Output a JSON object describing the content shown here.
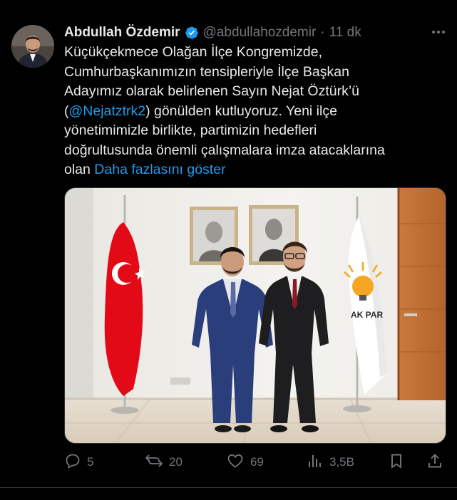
{
  "author": {
    "display_name": "Abdullah Özdemir",
    "handle": "@abdullahozdemir",
    "separator": "·",
    "time": "11 dk"
  },
  "tweet": {
    "line1": "Küçükçekmece Olağan İlçe Kongremizde,",
    "line2": "Cumhurbaşkanımızın tensipleriyle İlçe Başkan",
    "line3": "Adayımız olarak belirlenen Sayın Nejat Öztürk’ü",
    "line4_open": "(",
    "mention": "@Nejatztrk2",
    "line4_rest": ") gönülden kutluyoruz. Yeni ilçe",
    "line5": "yönetimimizle birlikte, partimizin hedefleri",
    "line6": "doğrultusunda önemli çalışmalara imza atacaklarına",
    "line7": "olan",
    "show_more": "Daha fazlasını göster"
  },
  "media": {
    "flag_text": "AK PAR"
  },
  "actions": {
    "replies": "5",
    "reposts": "20",
    "likes": "69",
    "views": "3,5B"
  },
  "colors": {
    "background": "#000000",
    "text": "#e7e9ea",
    "muted": "#71767b",
    "accent": "#1d9bf0",
    "verified": "#1d9bf0"
  },
  "icons": [
    "more-icon",
    "verified-icon",
    "reply-icon",
    "repost-icon",
    "like-icon",
    "views-icon",
    "bookmark-icon",
    "share-icon"
  ]
}
